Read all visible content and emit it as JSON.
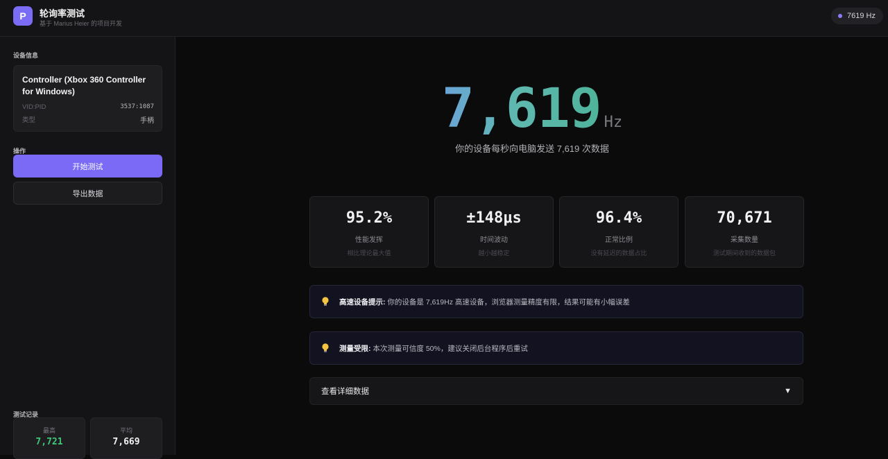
{
  "header": {
    "logo_letter": "P",
    "title": "轮询率测试",
    "subtitle": "基于 Marius Heier 的项目开发",
    "rate_badge": "7619 Hz"
  },
  "sidebar": {
    "device_section": "设备信息",
    "device": {
      "name": "Controller (Xbox 360 Controller for Windows)",
      "vidpid_label": "VID:PID",
      "vidpid_value": "3537:1087",
      "type_label": "类型",
      "type_value": "手柄"
    },
    "actions_section": "操作",
    "start_button": "开始测试",
    "export_button": "导出数据",
    "records_section": "测试记录",
    "records": [
      {
        "label": "最高",
        "value": "7,721",
        "color": "#3ec97a"
      },
      {
        "label": "平均",
        "value": "7,669",
        "color": "#f2f2f4"
      }
    ]
  },
  "main": {
    "rate_value": "7,619",
    "rate_unit": "Hz",
    "caption": "你的设备每秒向电脑发送 7,619 次数据",
    "stats": [
      {
        "value": "95.2%",
        "label": "性能发挥",
        "desc": "相比理论最大值"
      },
      {
        "value": "±148μs",
        "label": "时间波动",
        "desc": "越小越稳定"
      },
      {
        "value": "96.4%",
        "label": "正常比例",
        "desc": "没有延迟的数据占比"
      },
      {
        "value": "70,671",
        "label": "采集数量",
        "desc": "测试期间收到的数据包"
      }
    ],
    "tips": [
      {
        "title": "高速设备提示:",
        "text": "你的设备是 7,619Hz 高速设备，浏览器测量精度有限，结果可能有小幅误差"
      },
      {
        "title": "测量受限:",
        "text": "本次测量可信度 50%，建议关闭后台程序后重试"
      }
    ],
    "details_label": "查看详细数据",
    "details_arrow": "▼"
  },
  "colors": {
    "accent": "#7a6af5",
    "success": "#3ec97a",
    "gradient_start": "#6aa4d8",
    "gradient_end": "#4fb39a"
  }
}
